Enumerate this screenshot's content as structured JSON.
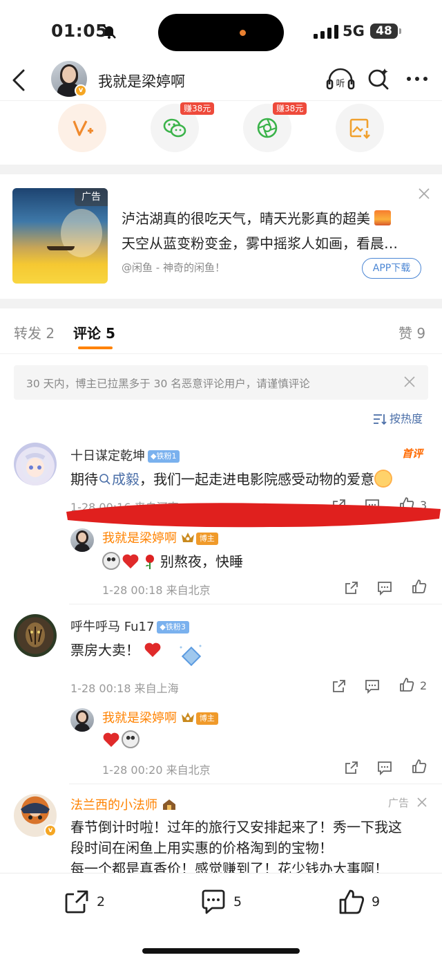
{
  "status_bar": {
    "time": "01:05",
    "network": "5G",
    "battery": "48"
  },
  "nav": {
    "title": "我就是梁婷啊",
    "listen_label": "听",
    "v_badge": "v"
  },
  "share": {
    "earn_wechat": "赚38元",
    "earn_moments": "赚38元",
    "icons": [
      "vplus-icon",
      "wechat-icon",
      "moments-icon",
      "save-image-icon"
    ]
  },
  "ad": {
    "tag": "广告",
    "line1": "泸沽湖真的很吃天气，晴天光影真的超美",
    "line2": "天空从蓝变粉变金，雾中摇浆人如画，看晨…",
    "source": "@闲鱼 - 神奇的闲鱼！",
    "button": "APP下载"
  },
  "tabs": {
    "repost_label": "转发",
    "repost_count": "2",
    "comment_label": "评论",
    "comment_count": "5",
    "like_label": "赞",
    "like_count": "9"
  },
  "notice": "30 天内，博主已拉黑多于 30 名恶意评论用户，请谨慎评论",
  "sort_label": "按热度",
  "comments": [
    {
      "name": "十日谋定乾坤",
      "badge": "铁粉1",
      "hot": "首评",
      "text_prefix": "期待",
      "mention": "成毅",
      "text_suffix": "，我们一起走进电影院感受动物的爱意",
      "meta": "1-28 00:16 来自河南",
      "likes": "3",
      "reply": {
        "name": "我就是梁婷啊",
        "owner_badge": "博主",
        "text": "别熬夜，快睡",
        "meta": "1-28 00:18 来自北京"
      }
    },
    {
      "name": "呼牛呼马 Fu17",
      "badge": "铁粉3",
      "text": "票房大卖！",
      "meta": "1-28 00:18 来自上海",
      "likes": "2",
      "reply": {
        "name": "我就是梁婷啊",
        "owner_badge": "博主",
        "meta": "1-28 00:20 来自北京"
      }
    },
    {
      "name": "法兰西的小法师",
      "ad_tag": "广告",
      "line1": "春节倒计时啦！过年的旅行又安排起来了！秀一下我这",
      "line2": "段时间在闲鱼上用实惠的价格淘到的宝物！",
      "line3": "每一个都是真香价！感觉赚到了！花少钱办大事啊！"
    }
  ],
  "bottom_bar": {
    "repost_count": "2",
    "comment_count": "5",
    "like_count": "9"
  },
  "colors": {
    "accent": "#ff8200",
    "link": "#4b6fa8",
    "fan_badge": "#7ab1ee",
    "redact": "#e0201e"
  }
}
